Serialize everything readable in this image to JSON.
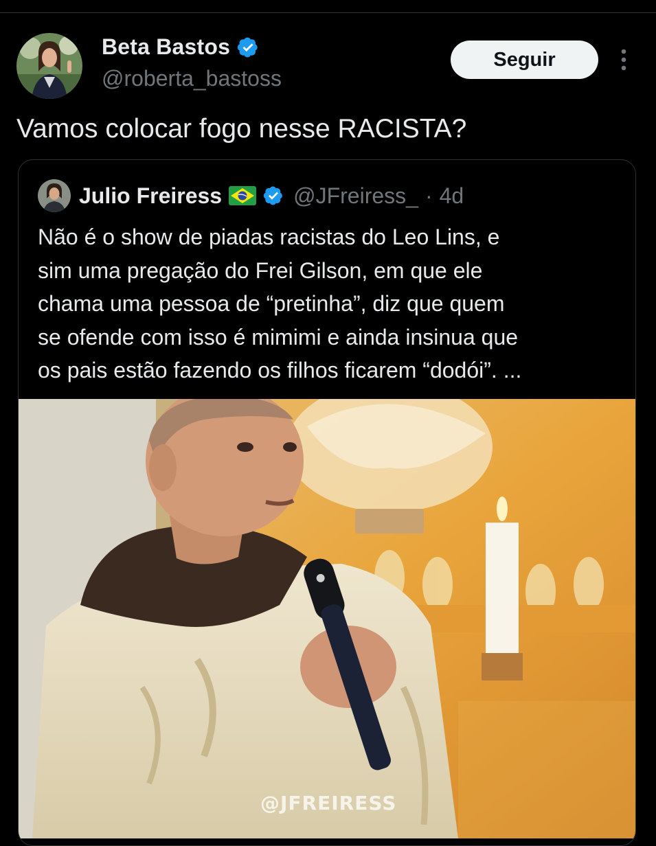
{
  "tweet": {
    "author_name": "Beta Bastos",
    "author_handle": "@roberta_bastoss",
    "follow_label": "Seguir",
    "text": "Vamos colocar fogo nesse RACISTA?"
  },
  "quoted_tweet": {
    "author_name": "Julio Freiress",
    "author_handle": "@JFreiress_",
    "separator": "·",
    "time": "4d",
    "text_lines": [
      "Não é o show de piadas racistas do Leo Lins, e",
      "sim uma pregação do Frei Gilson, em que ele",
      "chama uma pessoa de “pretinha”, diz que quem",
      "se ofende com isso é mimimi e ainda insinua que",
      "os pais estão fazendo os filhos ficarem “dodói”. ..."
    ],
    "media_watermark": "@JFREIRESS"
  },
  "icons": {
    "verified": "verified-badge-icon",
    "more": "more-vertical-icon",
    "flag": "brazil-flag-icon"
  },
  "colors": {
    "background": "#000000",
    "text_primary": "#e7e9ea",
    "text_secondary": "#71767b",
    "verified_blue": "#1d9bf0",
    "border": "#2f3336",
    "button_bg": "#eff3f4"
  }
}
